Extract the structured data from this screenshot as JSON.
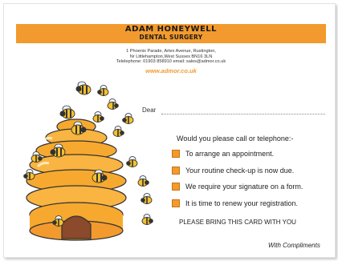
{
  "header": {
    "name": "ADAM HONEYWELL",
    "subtitle": "DENTAL SURGERY"
  },
  "address": {
    "line1": "1 Phoenix Parade, Artex Avenue, Rustington,",
    "line2": "Nr Littlehampton,West Sussex BN16 3LN",
    "line3": "Telelephone: 01903 858910    email: sales@admor.co.uk"
  },
  "website": "www.admor.co.uk",
  "dear_label": "Dear",
  "prompt": "Would you please call or telephone:-",
  "options": [
    "To arrange an appointment.",
    "Your routine check-up is now due.",
    "We require your signature on a form.",
    "It is time to renew your registration."
  ],
  "bring_note": "PLEASE BRING THIS CARD WITH YOU",
  "compliments": "With Compliments",
  "colors": {
    "accent": "#f29a2e",
    "hive": "#f7a92f",
    "door": "#8a4a2b"
  },
  "illustration": "beehive-with-bees"
}
